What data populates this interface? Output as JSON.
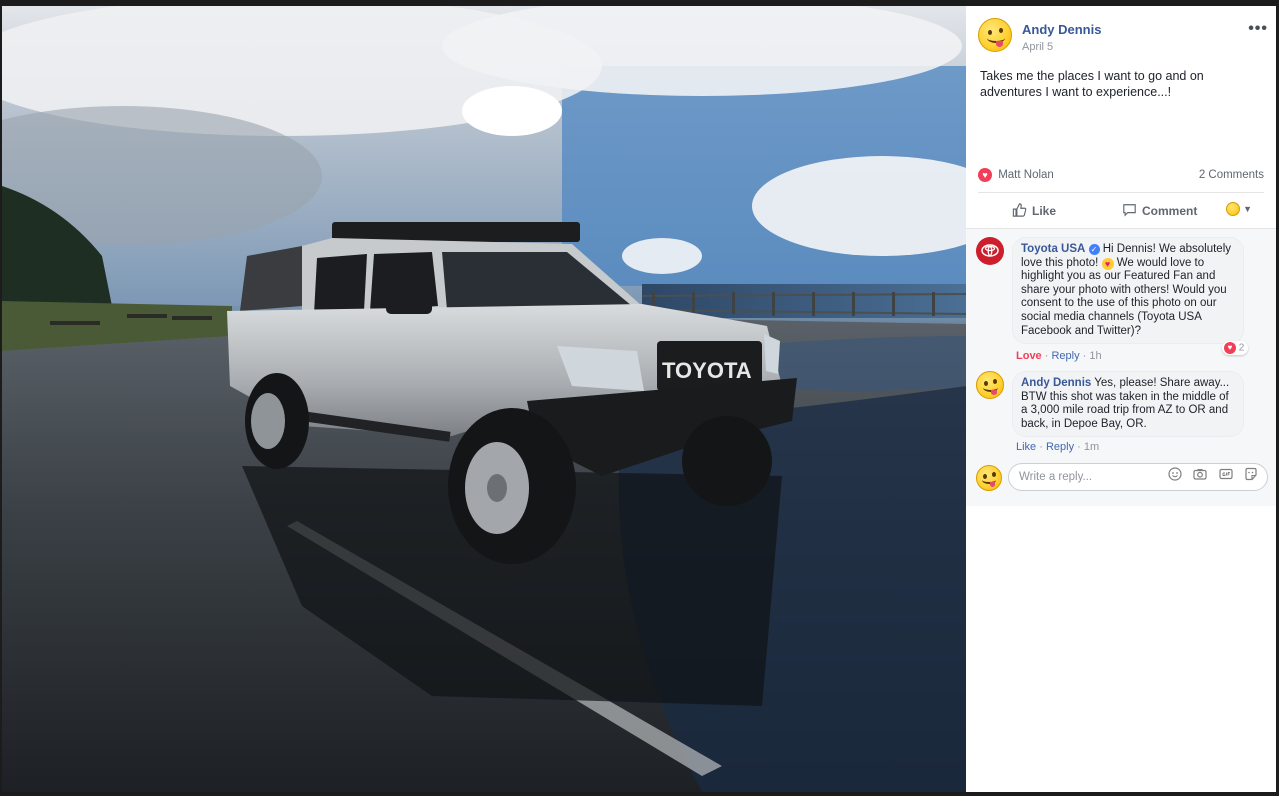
{
  "post": {
    "author": "Andy Dennis",
    "date": "April 5",
    "more": "•••",
    "text": "Takes me the places I want to go and on adventures I want to experience...!"
  },
  "photo": {
    "grille_text": "TOYOTA"
  },
  "reactions": {
    "reactor": "Matt Nolan",
    "comment_count": "2 Comments"
  },
  "actions": {
    "like": "Like",
    "comment": "Comment"
  },
  "comments": [
    {
      "author": "Toyota USA",
      "text_before_emoji": "Hi Dennis! We absolutely love this photo!",
      "text_after_emoji": "We would love to highlight you as our Featured Fan and share your photo with others! Would you consent to the use of this photo on our social media channels (Toyota USA Facebook and Twitter)?",
      "meta_love": "Love",
      "meta_reply": "Reply",
      "meta_time": "1h",
      "reaction_count": "2"
    },
    {
      "author": "Andy Dennis",
      "text": "Yes, please! Share away... BTW this shot was taken in the middle of a 3,000 mile road trip from AZ to OR and back, in Depoe Bay, OR.",
      "meta_like": "Like",
      "meta_reply": "Reply",
      "meta_time": "1m"
    }
  ],
  "reply": {
    "placeholder": "Write a reply..."
  },
  "colors": {
    "link_blue": "#385898",
    "love_red": "#f33e58",
    "toyota_red": "#cc1e2c"
  }
}
